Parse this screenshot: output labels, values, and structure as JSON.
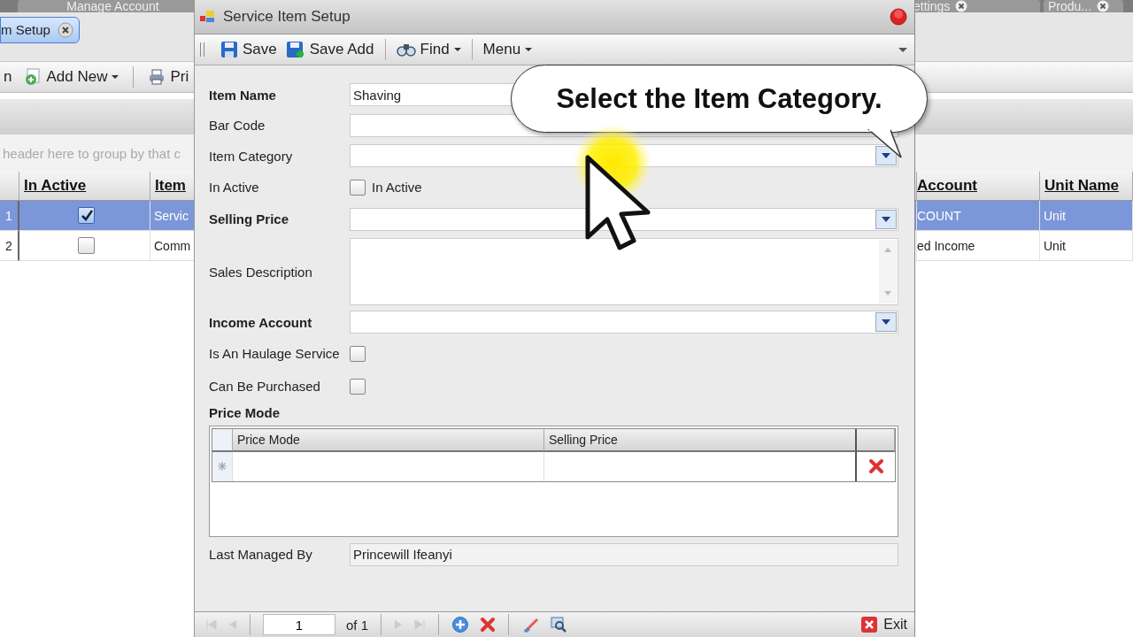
{
  "background_app": {
    "document_tabs": [
      {
        "label": "Manage Account",
        "closable": false
      },
      {
        "label": "ettings",
        "closable": true
      },
      {
        "label": "Produ...",
        "closable": true
      }
    ],
    "open_tab": {
      "label": "m Setup",
      "selected": true
    },
    "toolbar": [
      {
        "label": "n",
        "kind": "text"
      },
      {
        "label": "Add New",
        "kind": "add"
      },
      {
        "label": "Pri",
        "kind": "print"
      }
    ],
    "group_hint": "header here to group by that c",
    "grid": {
      "columns": [
        "In Active",
        "Item",
        "Account",
        "Unit Name"
      ],
      "rows": [
        {
          "number": "1",
          "in_active": true,
          "item": "Servic",
          "account": "COUNT",
          "unit_name": "Unit",
          "selected": true
        },
        {
          "number": "2",
          "in_active": false,
          "item": "Comm",
          "account": "ed Income",
          "unit_name": "Unit",
          "selected": false
        }
      ]
    }
  },
  "dialog": {
    "title": "Service Item Setup",
    "toolbar": [
      {
        "label": "Save",
        "kind": "save"
      },
      {
        "label": "Save Add",
        "kind": "save_add"
      },
      {
        "label": "Find",
        "kind": "find"
      },
      {
        "label": "Menu",
        "kind": "menu"
      }
    ],
    "fields": [
      {
        "label": "Item Name",
        "bold": true,
        "kind": "text",
        "value": "Shaving"
      },
      {
        "label": "Bar Code",
        "bold": false,
        "kind": "text"
      },
      {
        "label": "Item Category",
        "bold": false,
        "kind": "combo"
      },
      {
        "label": "In Active",
        "bold": false,
        "kind": "check",
        "checked": false,
        "caption": "In Active"
      },
      {
        "label": "Selling Price",
        "bold": true,
        "kind": "combo"
      },
      {
        "label": "Sales Description",
        "bold": false,
        "kind": "memo"
      },
      {
        "label": "Income Account",
        "bold": true,
        "kind": "combo"
      },
      {
        "label": "Is An Haulage Service",
        "bold": false,
        "kind": "check",
        "checked": false
      },
      {
        "label": "Can Be Purchased",
        "bold": false,
        "kind": "check",
        "checked": false
      }
    ],
    "price_mode": {
      "title": "Price Mode",
      "columns": [
        "Price Mode",
        "Selling Price"
      ]
    },
    "last_managed_by": {
      "label": "Last Managed By",
      "value": "Princewill Ifeanyi"
    },
    "pager": {
      "page": "1",
      "of": "of 1"
    },
    "exit": "Exit"
  },
  "callout": "Select the Item Category."
}
